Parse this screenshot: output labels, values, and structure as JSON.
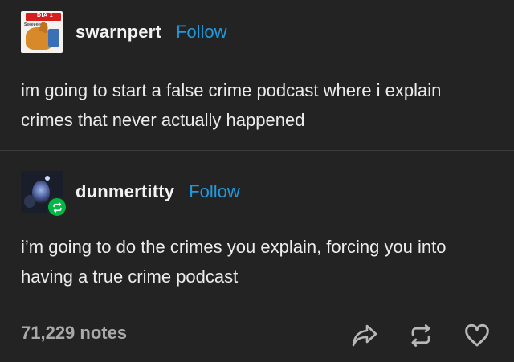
{
  "posts": [
    {
      "username": "swarnpert",
      "follow_label": "Follow",
      "avatar_banner": "DÍA 1",
      "avatar_subline": "Seeeeeeeee",
      "text": "im going to start a false crime podcast where i explain crimes that never actually happened"
    },
    {
      "username": "dunmertitty",
      "follow_label": "Follow",
      "text": "i’m going to do the crimes you explain, forcing you into having a true crime podcast"
    }
  ],
  "footer": {
    "notes": "71,229 notes",
    "icons": [
      "share-icon",
      "reblog-icon",
      "heart-icon"
    ]
  },
  "colors": {
    "background": "#232323",
    "follow": "#1e9be0",
    "reblog_badge": "#00b843",
    "notes_text": "#a9a9a9"
  }
}
